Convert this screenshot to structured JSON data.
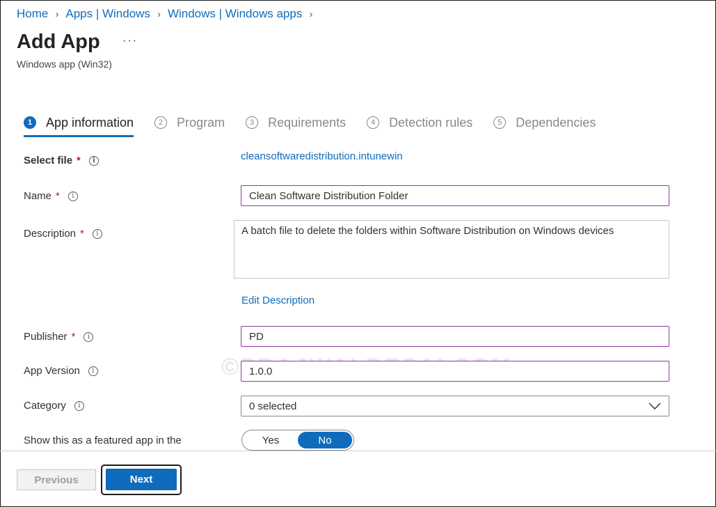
{
  "breadcrumb": [
    "Home",
    "Apps | Windows",
    "Windows | Windows apps"
  ],
  "page": {
    "title": "Add App",
    "more": "···",
    "subtitle": "Windows app (Win32)"
  },
  "steps": [
    {
      "num": "1",
      "label": "App information",
      "active": true
    },
    {
      "num": "2",
      "label": "Program"
    },
    {
      "num": "3",
      "label": "Requirements"
    },
    {
      "num": "4",
      "label": "Detection rules"
    },
    {
      "num": "5",
      "label": "Dependencies"
    }
  ],
  "form": {
    "select_file": {
      "label": "Select file",
      "required": "*",
      "value": "cleansoftwaredistribution.intunewin"
    },
    "name": {
      "label": "Name",
      "required": "*",
      "value": "Clean Software Distribution Folder"
    },
    "description": {
      "label": "Description",
      "required": "*",
      "value": "A batch file to delete the folders within Software Distribution on Windows devices",
      "edit_link": "Edit Description"
    },
    "publisher": {
      "label": "Publisher",
      "required": "*",
      "value": "PD"
    },
    "app_version": {
      "label": "App Version",
      "value": "1.0.0"
    },
    "category": {
      "label": "Category",
      "value": "0 selected"
    },
    "featured": {
      "label": "Show this as a featured app in the",
      "yes": "Yes",
      "no": "No",
      "selected": "No"
    }
  },
  "watermark": "©PRAJWALDESAI.COM",
  "footer": {
    "previous": "Previous",
    "next": "Next"
  },
  "colors": {
    "accent": "#0f6cbd",
    "field_border": "#8a3b9c",
    "required": "#a4262c"
  }
}
